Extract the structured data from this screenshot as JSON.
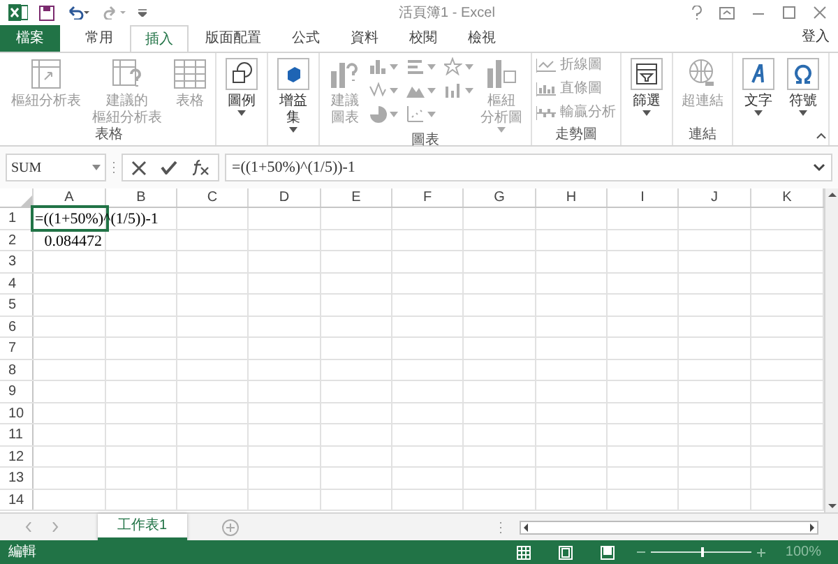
{
  "window": {
    "title": "活頁簿1 - Excel"
  },
  "ribbon_tabs": [
    {
      "label": "檔案",
      "kind": "file",
      "selected": false
    },
    {
      "label": "常用",
      "kind": "tab",
      "selected": false
    },
    {
      "label": "插入",
      "kind": "tab",
      "selected": true
    },
    {
      "label": "版面配置",
      "kind": "tab",
      "selected": false
    },
    {
      "label": "公式",
      "kind": "tab",
      "selected": false
    },
    {
      "label": "資料",
      "kind": "tab",
      "selected": false
    },
    {
      "label": "校閱",
      "kind": "tab",
      "selected": false
    },
    {
      "label": "檢視",
      "kind": "tab",
      "selected": false
    }
  ],
  "sign_in": "登入",
  "ribbon_groups": [
    {
      "label": "表格",
      "items": [
        {
          "kind": "large",
          "lines": [
            "樞紐分析表"
          ],
          "disabled": true,
          "dropdown": false
        },
        {
          "kind": "large",
          "lines": [
            "建議的",
            "樞紐分析表"
          ],
          "disabled": true,
          "dropdown": false
        },
        {
          "kind": "large",
          "lines": [
            "表格"
          ],
          "disabled": true,
          "dropdown": false
        }
      ]
    },
    {
      "items": [
        {
          "kind": "large",
          "lines": [
            "圖例"
          ],
          "disabled": false,
          "dropdown": true
        }
      ]
    },
    {
      "items": [
        {
          "kind": "large",
          "lines": [
            "增益",
            "集"
          ],
          "disabled": false,
          "dropdown": true
        }
      ]
    },
    {
      "label": "圖表",
      "items": [
        {
          "kind": "large",
          "lines": [
            "建議",
            "圖表"
          ],
          "disabled": true,
          "dropdown": false
        },
        {
          "kind": "gallery",
          "disabled": true
        },
        {
          "kind": "large",
          "lines": [
            "樞紐",
            "分析圖"
          ],
          "disabled": true,
          "dropdown": true
        }
      ]
    },
    {
      "label": "走勢圖",
      "items": [
        {
          "kind": "small",
          "lines": [
            "折線圖"
          ],
          "disabled": true
        },
        {
          "kind": "small",
          "lines": [
            "直條圖"
          ],
          "disabled": true
        },
        {
          "kind": "small",
          "lines": [
            "輸贏分析"
          ],
          "disabled": true
        }
      ]
    },
    {
      "items": [
        {
          "kind": "large",
          "lines": [
            "篩選"
          ],
          "disabled": false,
          "dropdown": true
        }
      ]
    },
    {
      "label": "連結",
      "items": [
        {
          "kind": "large",
          "lines": [
            "超連結"
          ],
          "disabled": true,
          "dropdown": false
        }
      ]
    },
    {
      "items": [
        {
          "kind": "large",
          "lines": [
            "文字"
          ],
          "disabled": false,
          "dropdown": true
        },
        {
          "kind": "large",
          "lines": [
            "符號"
          ],
          "disabled": false,
          "dropdown": true
        }
      ]
    }
  ],
  "name_box": "SUM",
  "formula": "=((1+50%)^(1/5))-1",
  "columns": [
    "A",
    "B",
    "C",
    "D",
    "E",
    "F",
    "G",
    "H",
    "I",
    "J",
    "K"
  ],
  "rows": [
    {
      "header": "1",
      "cells": [
        {
          "text": "=((1+50%)^(1/5))-1",
          "kind": "text"
        }
      ]
    },
    {
      "header": "2",
      "cells": [
        {
          "text": "0.084472",
          "kind": "number"
        }
      ]
    },
    {
      "header": "3",
      "cells": []
    },
    {
      "header": "4",
      "cells": []
    },
    {
      "header": "5",
      "cells": []
    },
    {
      "header": "6",
      "cells": []
    },
    {
      "header": "7",
      "cells": []
    },
    {
      "header": "8",
      "cells": []
    },
    {
      "header": "9",
      "cells": []
    },
    {
      "header": "10",
      "cells": []
    },
    {
      "header": "11",
      "cells": []
    },
    {
      "header": "12",
      "cells": []
    },
    {
      "header": "13",
      "cells": []
    },
    {
      "header": "14",
      "cells": []
    }
  ],
  "sheets": [
    {
      "label": "工作表1",
      "selected": true
    }
  ],
  "status_bar": {
    "mode": "編輯",
    "zoom": {
      "level": 0.5
    },
    "zoom_text": "100%"
  }
}
